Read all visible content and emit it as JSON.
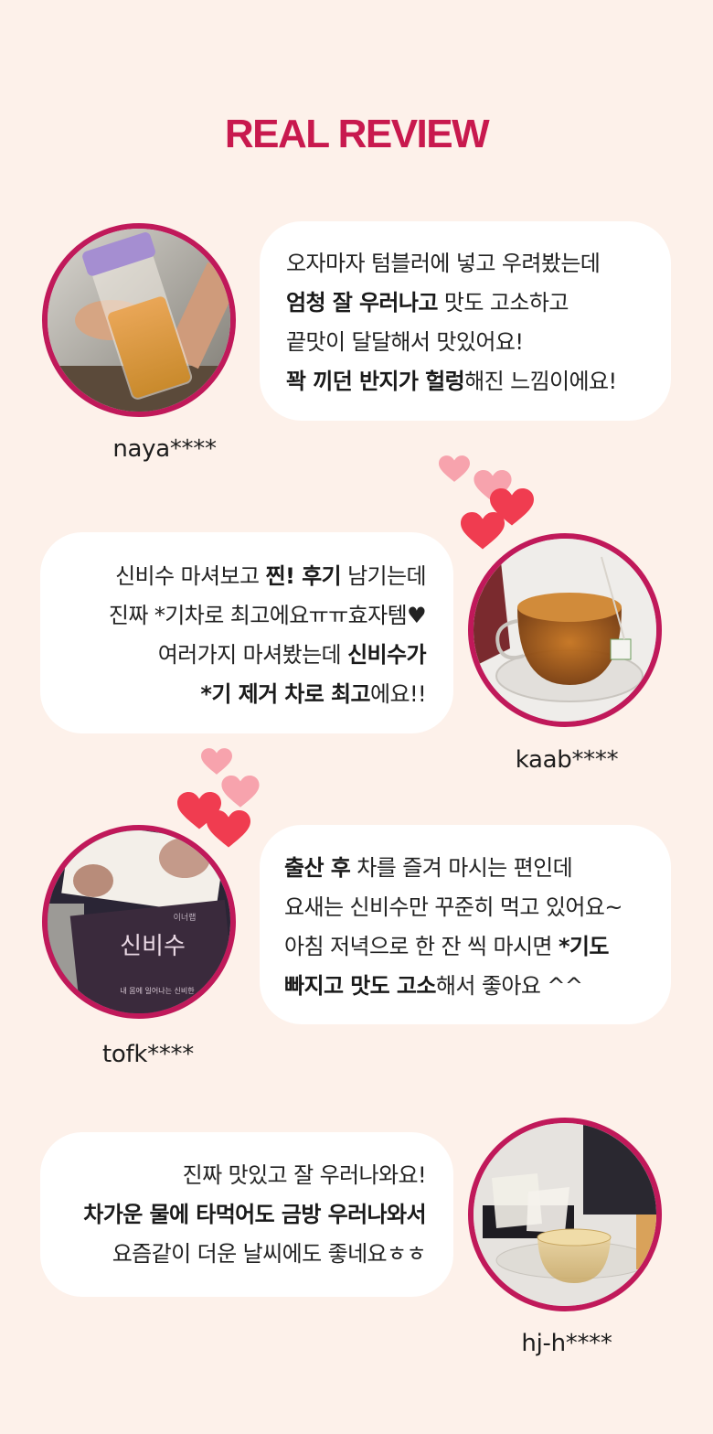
{
  "section_title": "REAL REVIEW",
  "colors": {
    "background": "#fdf1ea",
    "title": "#c8194e",
    "avatar_border": "#c0195a",
    "heart_light": "#f7a3ad",
    "heart_dark": "#f03c50"
  },
  "reviews": [
    {
      "user": "naya****",
      "lines": [
        [
          {
            "t": "오자마자 텀블러에 넣고 우려봤는데",
            "b": false
          }
        ],
        [
          {
            "t": "엄청 잘 우러나고",
            "b": true
          },
          {
            "t": " 맛도 고소하고",
            "b": false
          }
        ],
        [
          {
            "t": "끝맛이 달달해서 맛있어요!",
            "b": false
          }
        ],
        [
          {
            "t": "꽉 끼던 반지가 헐렁",
            "b": true
          },
          {
            "t": "해진 느낌이에요!",
            "b": false
          }
        ]
      ]
    },
    {
      "user": "kaab****",
      "lines": [
        [
          {
            "t": "신비수 마셔보고 ",
            "b": false
          },
          {
            "t": "찐! 후기",
            "b": true
          },
          {
            "t": " 남기는데",
            "b": false
          }
        ],
        [
          {
            "t": "진짜 *기차로 최고에요ㅠㅠ효자템♥",
            "b": false
          }
        ],
        [
          {
            "t": "여러가지 마셔봤는데 ",
            "b": false
          },
          {
            "t": "신비수가",
            "b": true
          }
        ],
        [
          {
            "t": "*기 제거 차로 최고",
            "b": true
          },
          {
            "t": "에요!!",
            "b": false
          }
        ]
      ]
    },
    {
      "user": "tofk****",
      "lines": [
        [
          {
            "t": "출산 후",
            "b": true
          },
          {
            "t": " 차를 즐겨 마시는 편인데",
            "b": false
          }
        ],
        [
          {
            "t": "요새는 신비수만 꾸준히 먹고 있어요~",
            "b": false
          }
        ],
        [
          {
            "t": "아침 저녁으로 한 잔 씩 마시면 ",
            "b": false
          },
          {
            "t": "*기도",
            "b": true
          }
        ],
        [
          {
            "t": "빠지고 맛도 고소",
            "b": true
          },
          {
            "t": "해서 좋아요 ^^",
            "b": false
          }
        ]
      ]
    },
    {
      "user": "hj-h****",
      "lines": [
        [
          {
            "t": "진짜 맛있고 잘 우러나와요!",
            "b": false
          }
        ],
        [
          {
            "t": "차가운 물에 타먹어도 금방 우러나와서",
            "b": true
          }
        ],
        [
          {
            "t": "요즘같이 더운 날씨에도 좋네요ㅎㅎ",
            "b": false
          }
        ]
      ]
    }
  ],
  "photo_text": {
    "product_name": "신비수",
    "brand": "이너랩",
    "tagline": "내 몸에 일어나는 신비한"
  },
  "icons": {
    "avatar_1": "tea-tumbler-photo",
    "avatar_2": "tea-cup-photo",
    "avatar_3": "product-package-photo",
    "avatar_4": "teabags-glass-photo",
    "heart": "heart-icon"
  }
}
